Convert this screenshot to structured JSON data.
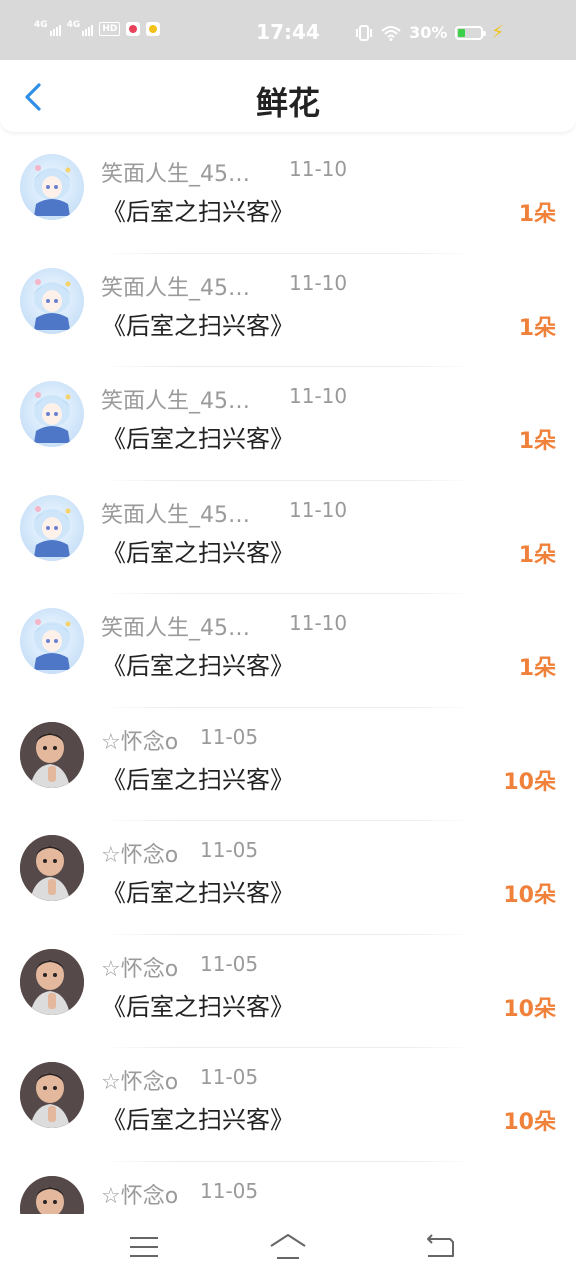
{
  "status_bar": {
    "network_1": "4G",
    "network_2": "4G",
    "hd": "HD",
    "time": "17:44",
    "battery_percent": "30%",
    "battery_level": 0.3
  },
  "header": {
    "title": "鲜花"
  },
  "colors": {
    "accent": "#2f8ee8",
    "amount": "#f0813a",
    "muted_text": "#9a9a9a"
  },
  "records": [
    {
      "user": "笑面人生_45…",
      "date": "11-10",
      "gift": "《后室之扫兴客》",
      "amount": "1朵",
      "avatar": "anime-girl-avatar"
    },
    {
      "user": "笑面人生_45…",
      "date": "11-10",
      "gift": "《后室之扫兴客》",
      "amount": "1朵",
      "avatar": "anime-girl-avatar"
    },
    {
      "user": "笑面人生_45…",
      "date": "11-10",
      "gift": "《后室之扫兴客》",
      "amount": "1朵",
      "avatar": "anime-girl-avatar"
    },
    {
      "user": "笑面人生_45…",
      "date": "11-10",
      "gift": "《后室之扫兴客》",
      "amount": "1朵",
      "avatar": "anime-girl-avatar"
    },
    {
      "user": "笑面人生_45…",
      "date": "11-10",
      "gift": "《后室之扫兴客》",
      "amount": "1朵",
      "avatar": "anime-girl-avatar"
    },
    {
      "user": "☆怀念o",
      "date": "11-05",
      "gift": "《后室之扫兴客》",
      "amount": "10朵",
      "avatar": "baby-photo-avatar"
    },
    {
      "user": "☆怀念o",
      "date": "11-05",
      "gift": "《后室之扫兴客》",
      "amount": "10朵",
      "avatar": "baby-photo-avatar"
    },
    {
      "user": "☆怀念o",
      "date": "11-05",
      "gift": "《后室之扫兴客》",
      "amount": "10朵",
      "avatar": "baby-photo-avatar"
    },
    {
      "user": "☆怀念o",
      "date": "11-05",
      "gift": "《后室之扫兴客》",
      "amount": "10朵",
      "avatar": "baby-photo-avatar"
    },
    {
      "user": "☆怀念o",
      "date": "11-05",
      "gift": "",
      "amount": "",
      "avatar": "baby-photo-avatar"
    }
  ],
  "nav_bar": {
    "items": [
      "menu-icon",
      "home-icon",
      "back-nav-icon"
    ]
  }
}
